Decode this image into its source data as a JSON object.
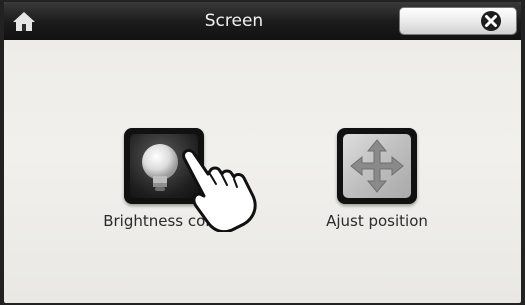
{
  "titlebar": {
    "title": "Screen",
    "home_icon": "home-icon",
    "close_icon": "close-icon"
  },
  "apps": [
    {
      "label": "Brightness color",
      "icon": "bulb-icon"
    },
    {
      "label": "Ajust position",
      "icon": "move-arrows-icon"
    }
  ],
  "overlay": {
    "icon": "pointing-hand-icon"
  },
  "colors": {
    "titlebar": "#1d1d1d",
    "screen_bg": "#ecebe7",
    "tile": "#111111",
    "label": "#2a2a2a"
  }
}
